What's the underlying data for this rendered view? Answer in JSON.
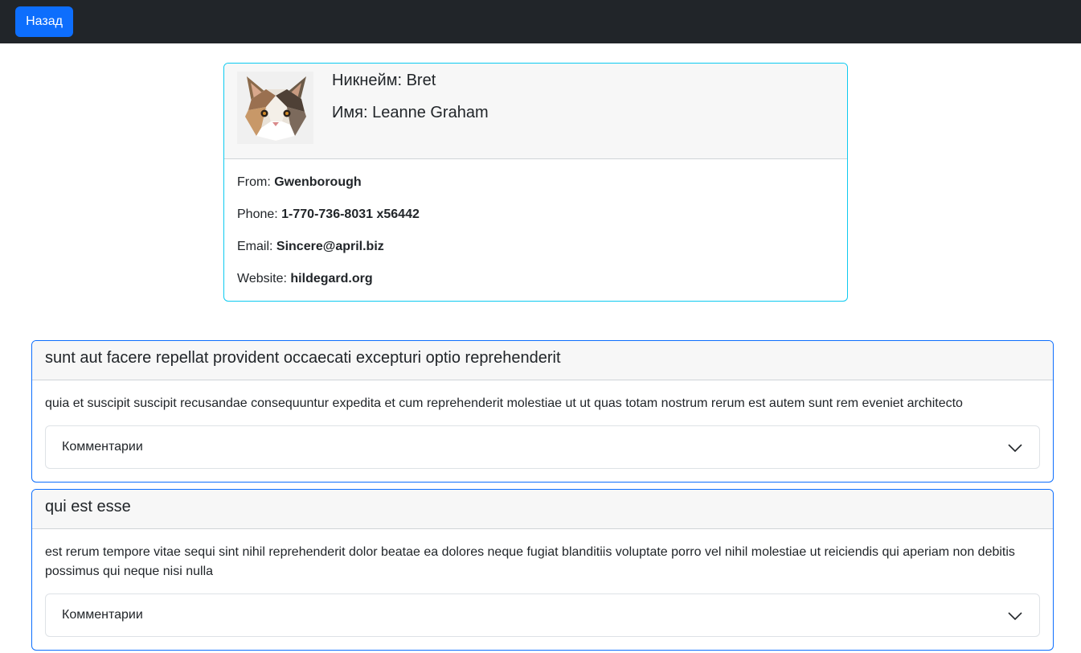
{
  "navbar": {
    "back_label": "Назад"
  },
  "user": {
    "nick_label": "Никнейм: ",
    "nick": "Bret",
    "name_label": "Имя: ",
    "name": "Leanne Graham",
    "from_label": "From: ",
    "from": "Gwenborough",
    "phone_label": "Phone: ",
    "phone": "1-770-736-8031 x56442",
    "email_label": "Email: ",
    "email": "Sincere@april.biz",
    "website_label": "Website: ",
    "website": "hildegard.org",
    "avatar_icon": "cat-avatar-icon"
  },
  "posts": [
    {
      "title": "sunt aut facere repellat provident occaecati excepturi optio reprehenderit",
      "body": "quia et suscipit suscipit recusandae consequuntur expedita et cum reprehenderit molestiae ut ut quas totam nostrum rerum est autem sunt rem eveniet architecto",
      "comments_label": "Комментарии"
    },
    {
      "title": "qui est esse",
      "body": "est rerum tempore vitae sequi sint nihil reprehenderit dolor beatae ea dolores neque fugiat blanditiis voluptate porro vel nihil molestiae ut reiciendis qui aperiam non debitis possimus qui neque nisi nulla",
      "comments_label": "Комментарии"
    }
  ],
  "colors": {
    "navbar_bg": "#212529",
    "primary": "#0d6efd",
    "info_border": "#0dcaf0"
  }
}
